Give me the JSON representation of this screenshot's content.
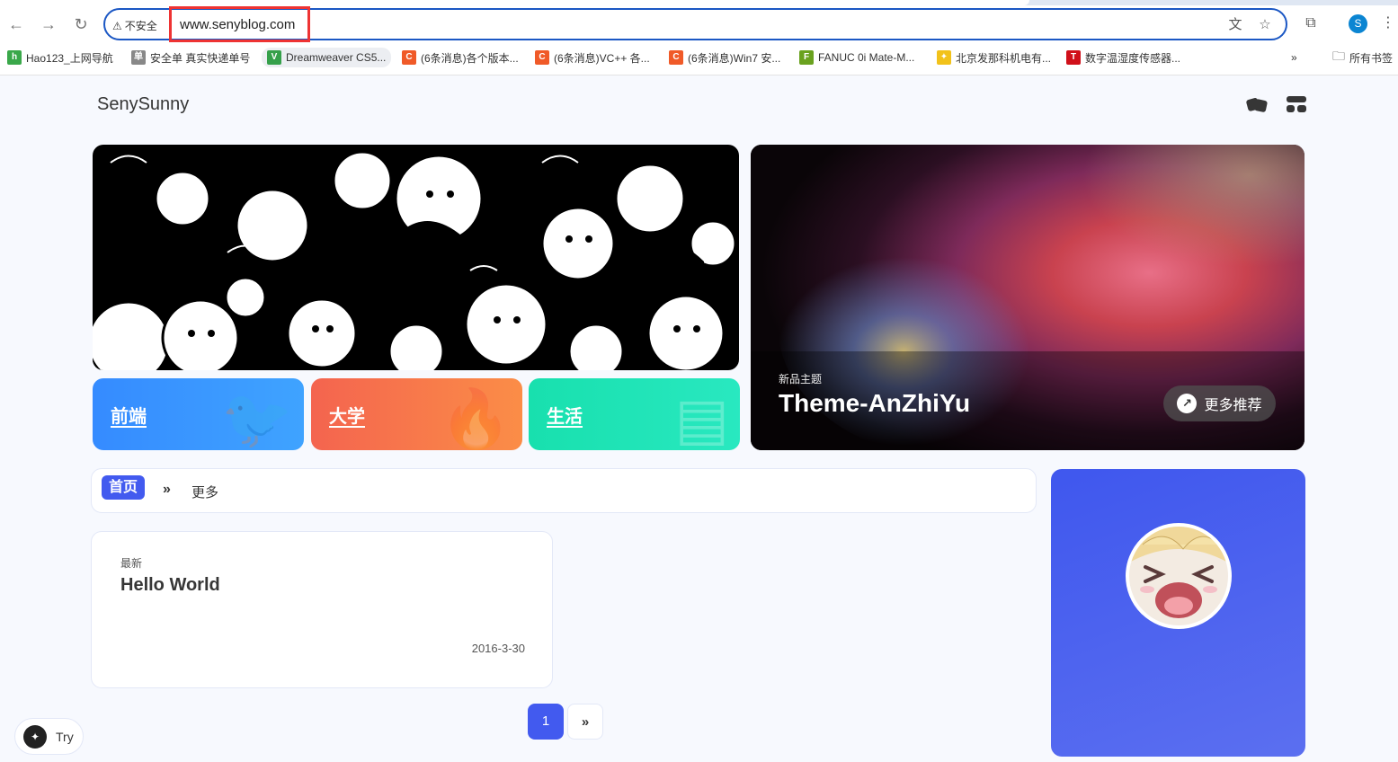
{
  "browser": {
    "security_label": "不安全",
    "url": "www.senyblog.com",
    "profile_initial": "S",
    "bookmarks": [
      {
        "label": "Hao123_上网导航",
        "color": "#3aa84a",
        "glyph": "h"
      },
      {
        "label": "安全单 真实快递单号",
        "color": "#888888",
        "glyph": "单"
      },
      {
        "label": "Dreamweaver CS5...",
        "color": "#35a04a",
        "glyph": "V"
      },
      {
        "label": "(6条消息)各个版本...",
        "color": "#f05a28",
        "glyph": "C"
      },
      {
        "label": "(6条消息)VC++ 各...",
        "color": "#f05a28",
        "glyph": "C"
      },
      {
        "label": "(6条消息)Win7 安...",
        "color": "#f05a28",
        "glyph": "C"
      },
      {
        "label": "FANUC 0i Mate-M...",
        "color": "#6aa21f",
        "glyph": "F"
      },
      {
        "label": "北京发那科机电有...",
        "color": "#f2c21a",
        "glyph": "✦"
      },
      {
        "label": "数字温湿度传感器...",
        "color": "#d0101a",
        "glyph": "T"
      }
    ],
    "all_bookmarks_label": "所有书签"
  },
  "site": {
    "brand": "SenySunny",
    "categories": [
      {
        "label": "前端"
      },
      {
        "label": "大学"
      },
      {
        "label": "生活"
      }
    ],
    "feature": {
      "tag": "新品主题",
      "title": "Theme-AnZhiYu",
      "more_label": "更多推荐"
    },
    "tabs": {
      "home_label": "首页",
      "more_label": "更多"
    },
    "post": {
      "tag": "最新",
      "title": "Hello World",
      "date": "2016-3-30"
    },
    "pagination": {
      "current": "1",
      "next_icon": "»"
    },
    "try_label": "Try"
  }
}
